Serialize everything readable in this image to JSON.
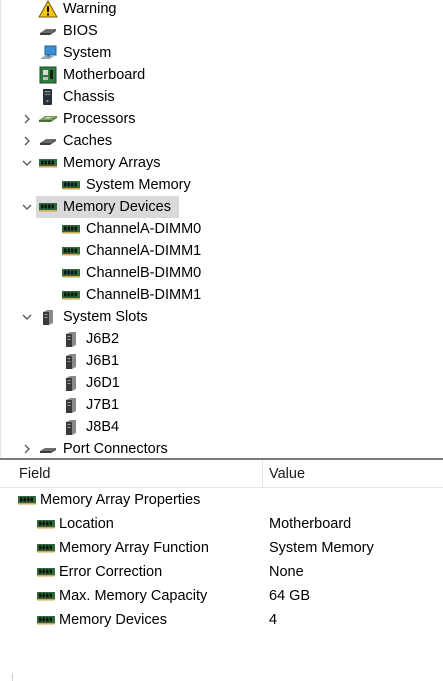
{
  "tree": {
    "items": [
      {
        "label": "Warning",
        "icon": "warning-icon",
        "expander": "none"
      },
      {
        "label": "BIOS",
        "icon": "chip-icon",
        "expander": "none"
      },
      {
        "label": "System",
        "icon": "computer-icon",
        "expander": "none"
      },
      {
        "label": "Motherboard",
        "icon": "motherboard-icon",
        "expander": "none"
      },
      {
        "label": "Chassis",
        "icon": "chassis-icon",
        "expander": "none"
      },
      {
        "label": "Processors",
        "icon": "processor-icon",
        "expander": "collapsed"
      },
      {
        "label": "Caches",
        "icon": "chip-icon",
        "expander": "collapsed"
      },
      {
        "label": "Memory Arrays",
        "icon": "memory-icon",
        "expander": "expanded"
      },
      {
        "label": "System Memory",
        "icon": "memory-icon",
        "expander": "none"
      },
      {
        "label": "Memory Devices",
        "icon": "memory-icon",
        "expander": "expanded",
        "selected": true
      },
      {
        "label": "ChannelA-DIMM0",
        "icon": "memory-icon",
        "expander": "none"
      },
      {
        "label": "ChannelA-DIMM1",
        "icon": "memory-icon",
        "expander": "none"
      },
      {
        "label": "ChannelB-DIMM0",
        "icon": "memory-icon",
        "expander": "none"
      },
      {
        "label": "ChannelB-DIMM1",
        "icon": "memory-icon",
        "expander": "none"
      },
      {
        "label": "System Slots",
        "icon": "slot-icon",
        "expander": "expanded"
      },
      {
        "label": "J6B2",
        "icon": "slot-icon",
        "expander": "none"
      },
      {
        "label": "J6B1",
        "icon": "slot-icon",
        "expander": "none"
      },
      {
        "label": "J6D1",
        "icon": "slot-icon",
        "expander": "none"
      },
      {
        "label": "J7B1",
        "icon": "slot-icon",
        "expander": "none"
      },
      {
        "label": "J8B4",
        "icon": "slot-icon",
        "expander": "none"
      },
      {
        "label": "Port Connectors",
        "icon": "connector-icon",
        "expander": "collapsed"
      }
    ]
  },
  "list": {
    "columns": {
      "field": "Field",
      "value": "Value"
    },
    "group": {
      "label": "Memory Array Properties",
      "icon": "memory-icon"
    },
    "rows": [
      {
        "field": "Location",
        "value": "Motherboard",
        "icon": "memory-icon"
      },
      {
        "field": "Memory Array Function",
        "value": "System Memory",
        "icon": "memory-icon"
      },
      {
        "field": "Error Correction",
        "value": "None",
        "icon": "memory-icon"
      },
      {
        "field": "Max. Memory Capacity",
        "value": "64 GB",
        "icon": "memory-icon"
      },
      {
        "field": "Memory Devices",
        "value": "4",
        "icon": "memory-icon"
      }
    ]
  },
  "colors": {
    "selection": "#d9d9d9",
    "divider": "#7b7b7b",
    "memory_green": "#2f6b3a",
    "warning_yellow": "#f5c518"
  }
}
